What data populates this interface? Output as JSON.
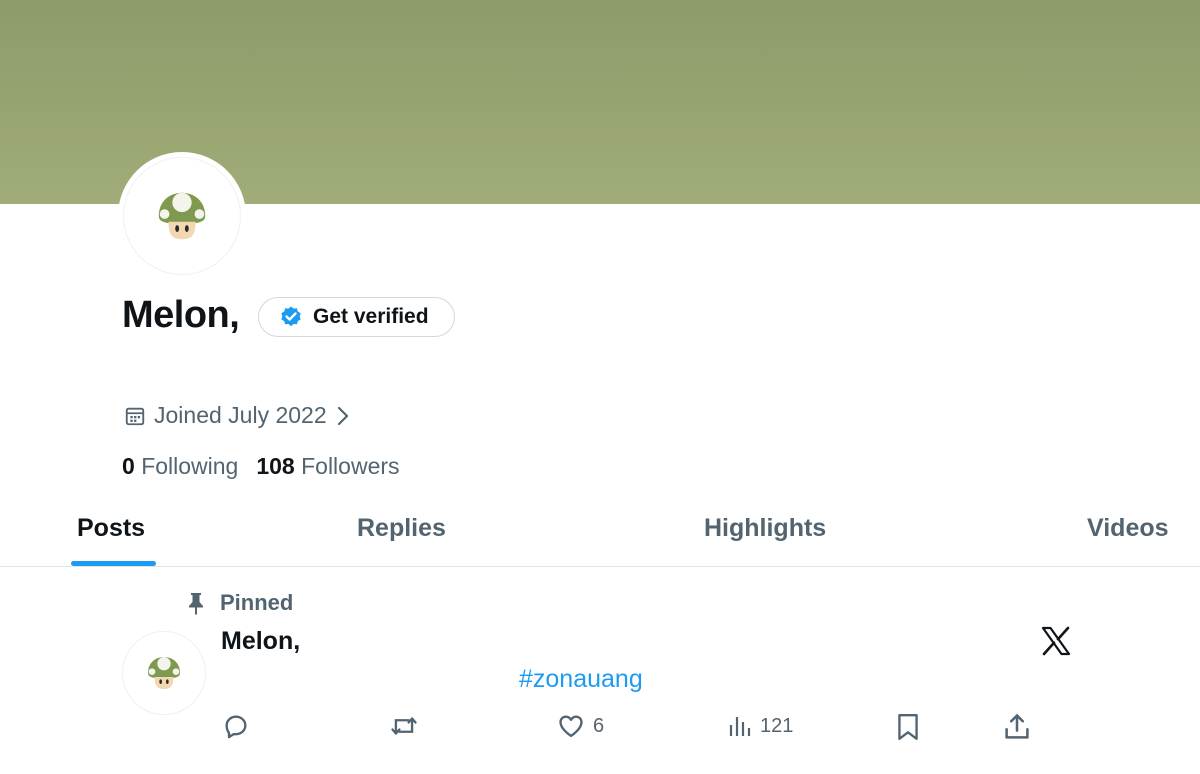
{
  "profile": {
    "display_name": "Melon,",
    "get_verified_label": "Get verified",
    "joined_text": "Joined July 2022",
    "following_count": "0",
    "following_label": "Following",
    "followers_count": "108",
    "followers_label": "Followers"
  },
  "tabs": [
    {
      "label": "Posts",
      "active": true
    },
    {
      "label": "Replies",
      "active": false
    },
    {
      "label": "Highlights",
      "active": false
    },
    {
      "label": "Videos",
      "active": false
    }
  ],
  "pinned_post": {
    "pinned_label": "Pinned",
    "author": "Melon,",
    "hashtag": "#zonauang",
    "likes": "6",
    "views": "121"
  },
  "colors": {
    "banner": "#9aa874",
    "accent": "#1d9bf0",
    "secondary_text": "#536471"
  },
  "icons": [
    "calendar-icon",
    "chevron-right-icon",
    "verified-badge-icon",
    "pin-icon",
    "x-logo-icon",
    "reply-icon",
    "repost-icon",
    "like-icon",
    "views-icon",
    "bookmark-icon",
    "share-icon",
    "mushroom-avatar"
  ]
}
